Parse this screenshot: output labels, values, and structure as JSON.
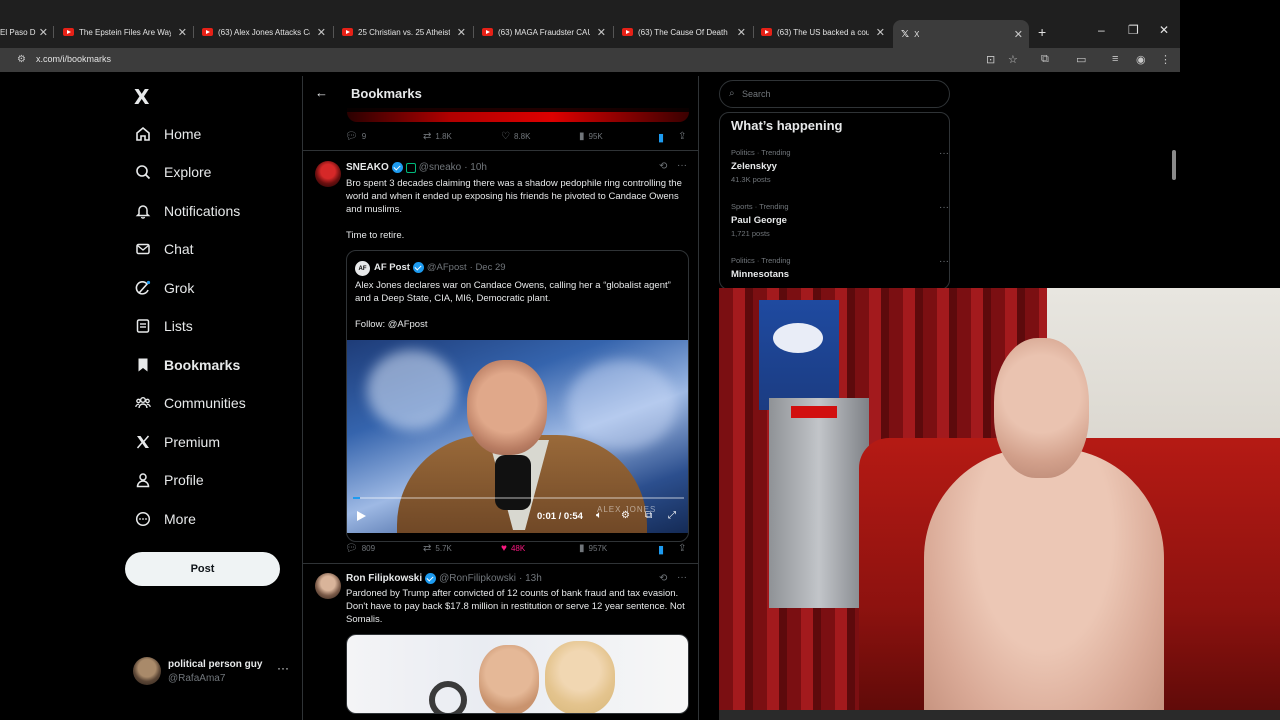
{
  "browser": {
    "tabs": [
      {
        "label": "El Paso D"
      },
      {
        "label": "The Epstein Files Are Way"
      },
      {
        "label": "(63) Alex Jones Attacks Ca"
      },
      {
        "label": "25 Christian vs. 25 Atheist"
      },
      {
        "label": "(63) MAGA Fraudster CAU"
      },
      {
        "label": "(63) The Cause Of Death"
      },
      {
        "label": "(63) The US backed a cou"
      },
      {
        "label": "X"
      }
    ],
    "new_tab": "+",
    "url": "x.com/i/bookmarks",
    "window_controls": [
      "–",
      "❐",
      "✕"
    ]
  },
  "nav": {
    "logo": "X",
    "items": [
      {
        "label": "Home",
        "icon": "home-icon"
      },
      {
        "label": "Explore",
        "icon": "search-icon"
      },
      {
        "label": "Notifications",
        "icon": "bell-icon"
      },
      {
        "label": "Chat",
        "icon": "mail-icon"
      },
      {
        "label": "Grok",
        "icon": "grok-icon"
      },
      {
        "label": "Lists",
        "icon": "list-icon"
      },
      {
        "label": "Bookmarks",
        "icon": "bookmark-icon"
      },
      {
        "label": "Communities",
        "icon": "people-icon"
      },
      {
        "label": "Premium",
        "icon": "x-icon"
      },
      {
        "label": "Profile",
        "icon": "person-icon"
      },
      {
        "label": "More",
        "icon": "more-circle-icon"
      }
    ],
    "post_button": "Post",
    "account": {
      "name": "political person guy",
      "handle": "@RafaAma7",
      "more": "···"
    }
  },
  "main": {
    "title": "Bookmarks",
    "back": "←",
    "top_actions": {
      "replies": "9",
      "reposts": "1.8K",
      "likes": "8.8K",
      "views": "95K"
    },
    "tweet1": {
      "name": "SNEAKO",
      "handle": "@sneako",
      "time": "· 10h",
      "text": "Bro spent 3 decades claiming there was a shadow pedophile ring controlling the world and when it ended up exposing his friends he pivoted to Candace Owens and muslims.\n\nTime to retire.",
      "quote": {
        "avatar": "AF",
        "name": "AF Post",
        "handle": "@AFpost",
        "time": "· Dec 29",
        "text": "Alex Jones declares war on Candace Owens, calling her a “globalist agent” and a Deep State, CIA, MI6, Democratic plant.\n\nFollow: @AFpost",
        "video_time": "0:01 / 0:54",
        "video_progress": 0.02,
        "watermark": "ALEX JONES"
      },
      "actions": {
        "replies": "809",
        "reposts": "5.7K",
        "likes": "48K",
        "views": "957K"
      }
    },
    "tweet2": {
      "name": "Ron Filipkowski",
      "handle": "@RonFilipkowski",
      "time": "· 13h",
      "text": "Pardoned by Trump after convicted of 12 counts of bank fraud and tax evasion. Don't have to pay back $17.8 million in restitution or serve 12 year sentence. Not Somalis."
    }
  },
  "right": {
    "search_placeholder": "Search",
    "trends_title": "What’s happening",
    "trends": [
      {
        "category": "Politics · Trending",
        "name": "Zelenskyy",
        "count": "41.3K posts"
      },
      {
        "category": "Sports · Trending",
        "name": "Paul George",
        "count": "1,721 posts"
      },
      {
        "category": "Politics · Trending",
        "name": "Minnesotans",
        "count": ""
      }
    ],
    "more": "···"
  },
  "colors": {
    "accent": "#1d9bf0",
    "like": "#f91880",
    "bg": "#000000",
    "border": "#2f3336",
    "muted": "#71767b"
  }
}
